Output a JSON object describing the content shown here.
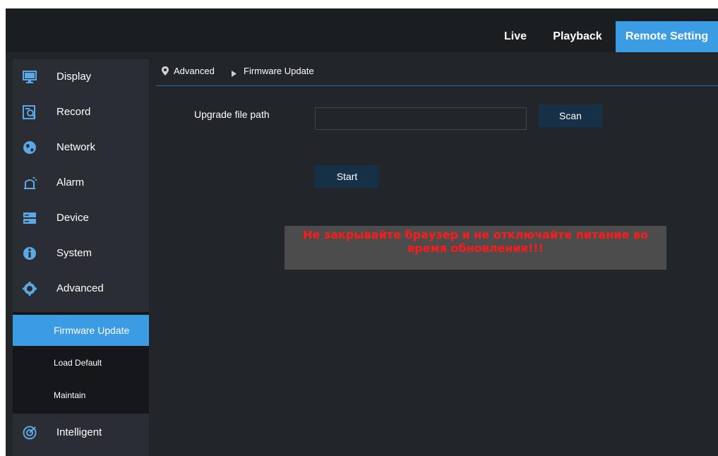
{
  "topnav": {
    "live": "Live",
    "playback": "Playback",
    "remote_setting": "Remote Setting",
    "active_color": "#3b9be3"
  },
  "sidebar": {
    "items": [
      {
        "label": "Display",
        "icon": "monitor-icon"
      },
      {
        "label": "Record",
        "icon": "record-icon"
      },
      {
        "label": "Network",
        "icon": "network-icon"
      },
      {
        "label": "Alarm",
        "icon": "alarm-icon"
      },
      {
        "label": "Device",
        "icon": "device-icon"
      },
      {
        "label": "System",
        "icon": "info-icon"
      },
      {
        "label": "Advanced",
        "icon": "gear-icon"
      },
      {
        "label": "Intelligent",
        "icon": "intelligent-icon"
      }
    ],
    "sub_items": [
      {
        "label": "Firmware Update",
        "active": true
      },
      {
        "label": "Load Default",
        "active": false
      },
      {
        "label": "Maintain",
        "active": false
      }
    ]
  },
  "breadcrumb": {
    "parent": "Advanced",
    "current": "Firmware Update"
  },
  "form": {
    "upgrade_label": "Upgrade file path",
    "path_value": "",
    "scan_label": "Scan",
    "start_label": "Start"
  },
  "warning": {
    "line1": "Не закрывайте браузер и не отключайте питание во",
    "line2": "время обновления!!!",
    "color": "#ff1a1a"
  }
}
